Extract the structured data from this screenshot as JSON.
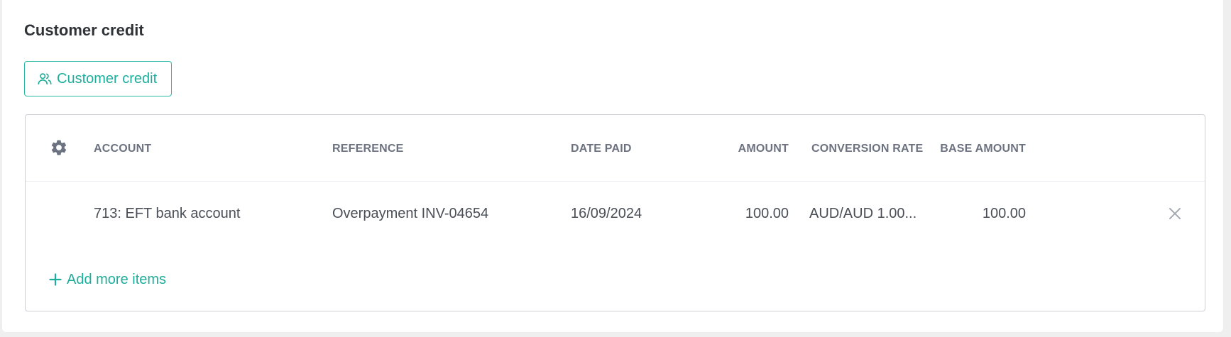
{
  "section": {
    "title": "Customer credit",
    "button_label": "Customer credit"
  },
  "table": {
    "headers": {
      "account": "ACCOUNT",
      "reference": "REFERENCE",
      "date_paid": "DATE PAID",
      "amount": "AMOUNT",
      "conversion_rate": "CONVERSION RATE",
      "base_amount": "BASE AMOUNT"
    },
    "rows": [
      {
        "account": "713: EFT bank account",
        "reference": "Overpayment INV-04654",
        "date_paid": "16/09/2024",
        "amount": "100.00",
        "conversion_rate": "AUD/AUD 1.00...",
        "base_amount": "100.00"
      }
    ],
    "add_more_label": "Add more items"
  },
  "icons": {
    "button_icon": "users-icon",
    "settings": "gear-icon",
    "remove": "close-icon",
    "add": "plus-icon"
  },
  "colors": {
    "accent": "#1fae9b",
    "header_text": "#6c7280",
    "body_text": "#4a4f57",
    "title_text": "#2f3337",
    "border": "#cdd0d8"
  }
}
